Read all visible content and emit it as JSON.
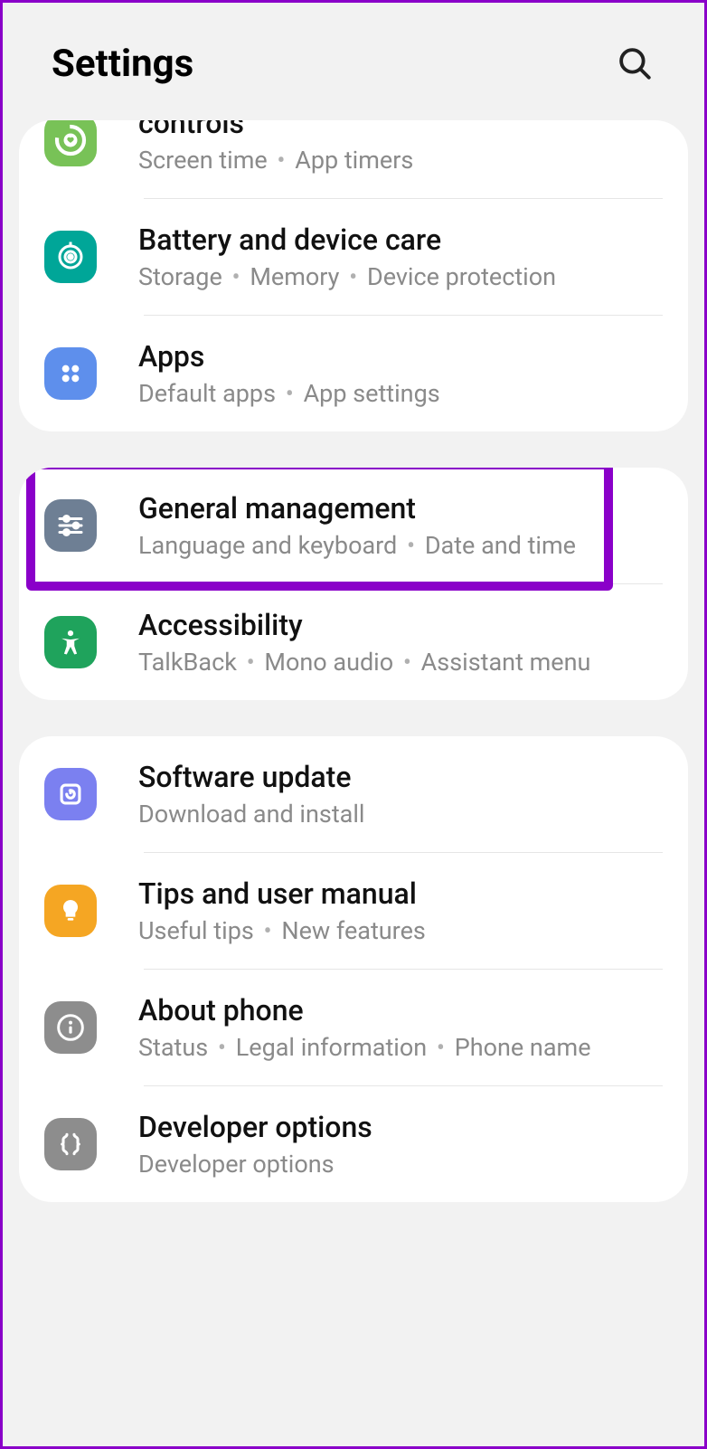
{
  "header": {
    "title": "Settings"
  },
  "groups": [
    {
      "rows": [
        {
          "icon": "wellbeing",
          "title": "controls",
          "sub": [
            "Screen time",
            "App timers"
          ],
          "partial": true
        },
        {
          "icon": "battery",
          "title": "Battery and device care",
          "sub": [
            "Storage",
            "Memory",
            "Device protection"
          ]
        },
        {
          "icon": "apps",
          "title": "Apps",
          "sub": [
            "Default apps",
            "App settings"
          ]
        }
      ]
    },
    {
      "rows": [
        {
          "icon": "general",
          "title": "General management",
          "sub": [
            "Language and keyboard",
            "Date and time"
          ],
          "highlight": true
        },
        {
          "icon": "a11y",
          "title": "Accessibility",
          "sub": [
            "TalkBack",
            "Mono audio",
            "Assistant menu"
          ]
        }
      ]
    },
    {
      "rows": [
        {
          "icon": "update",
          "title": "Software update",
          "sub": [
            "Download and install"
          ]
        },
        {
          "icon": "tips",
          "title": "Tips and user manual",
          "sub": [
            "Useful tips",
            "New features"
          ]
        },
        {
          "icon": "about",
          "title": "About phone",
          "sub": [
            "Status",
            "Legal information",
            "Phone name"
          ]
        },
        {
          "icon": "dev",
          "title": "Developer options",
          "sub": [
            "Developer options"
          ]
        }
      ]
    }
  ]
}
